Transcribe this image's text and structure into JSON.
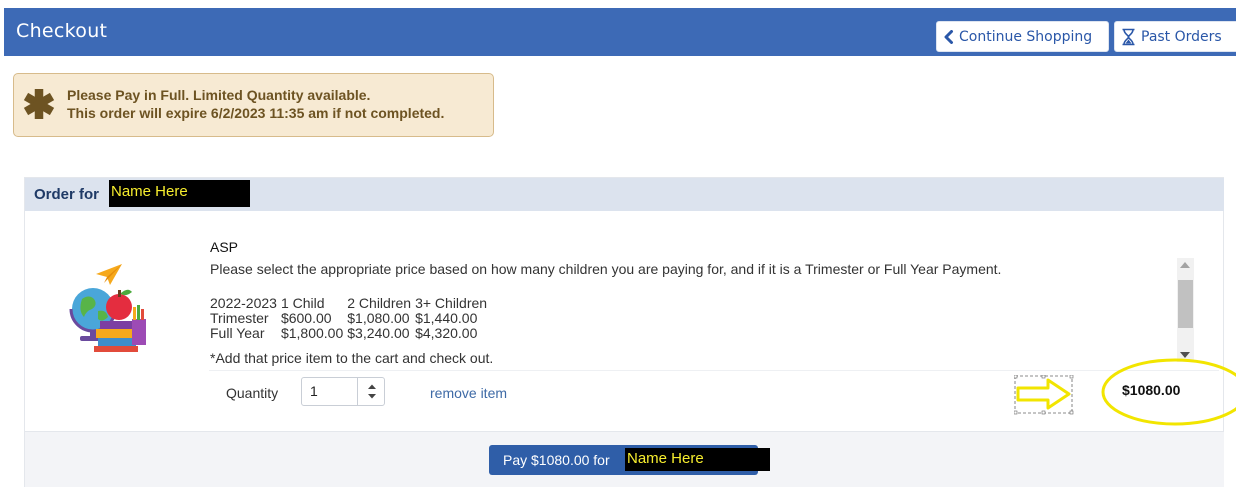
{
  "header": {
    "title": "Checkout",
    "continue_shopping": "Continue Shopping",
    "past_orders": "Past Orders",
    "bg_color": "#3d6ab6"
  },
  "alert": {
    "line1": "Please Pay in Full. Limited Quantity available.",
    "line2": "This order will expire 6/2/2023 11:35 am if not completed.",
    "icon": "asterisk-icon"
  },
  "order": {
    "order_for_label": "Order for",
    "name": "Name Here",
    "item": {
      "name": "ASP",
      "description": "Please select the appropriate price based on how many children you are paying for, and if it is a Trimester or Full Year Payment.",
      "price_table": {
        "headers": [
          "2022-2023",
          "1 Child",
          "2 Children",
          "3+ Children"
        ],
        "rows": [
          [
            "Trimester",
            "$600.00",
            "$1,080.00",
            "$1,440.00"
          ],
          [
            "Full Year",
            "$1,800.00",
            "$3,240.00",
            "$4,320.00"
          ]
        ]
      },
      "note": "*Add that price item to the cart and check out.",
      "quantity_label": "Quantity",
      "quantity_value": "1",
      "remove_label": "remove item",
      "line_total": "$1080.00"
    },
    "pay_button_label": "Pay $1080.00 for",
    "pay_name": "Name Here"
  }
}
